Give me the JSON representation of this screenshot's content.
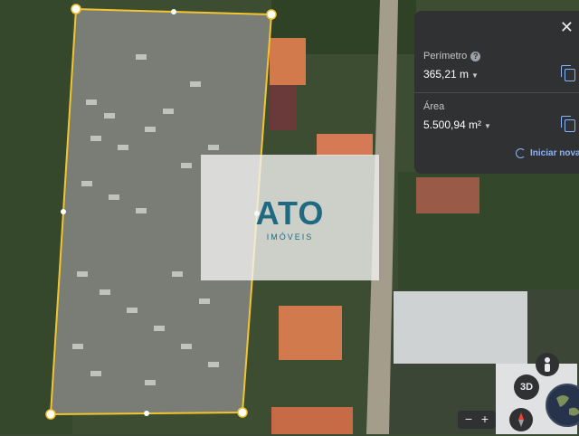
{
  "panel": {
    "close_symbol": "✕",
    "perimeter": {
      "label": "Perímetro",
      "help_symbol": "?",
      "value": "365,21 m",
      "caret": "▼"
    },
    "area": {
      "label": "Área",
      "value": "5.500,94 m²",
      "caret": "▼"
    },
    "restart_label": "Iniciar nova"
  },
  "logo": {
    "text": "ATO",
    "subtext": "IMÓVEIS"
  },
  "controls": {
    "btn_3d": "3D",
    "zoom_out": "−",
    "zoom_in": "+",
    "icons": [
      "pegman-icon",
      "compass-icon",
      "globe-icon"
    ]
  },
  "colors": {
    "measure_line": "#f2c530",
    "panel_bg": "#2f3133",
    "link": "#8ab4f8",
    "logo": "#1f6a80"
  }
}
